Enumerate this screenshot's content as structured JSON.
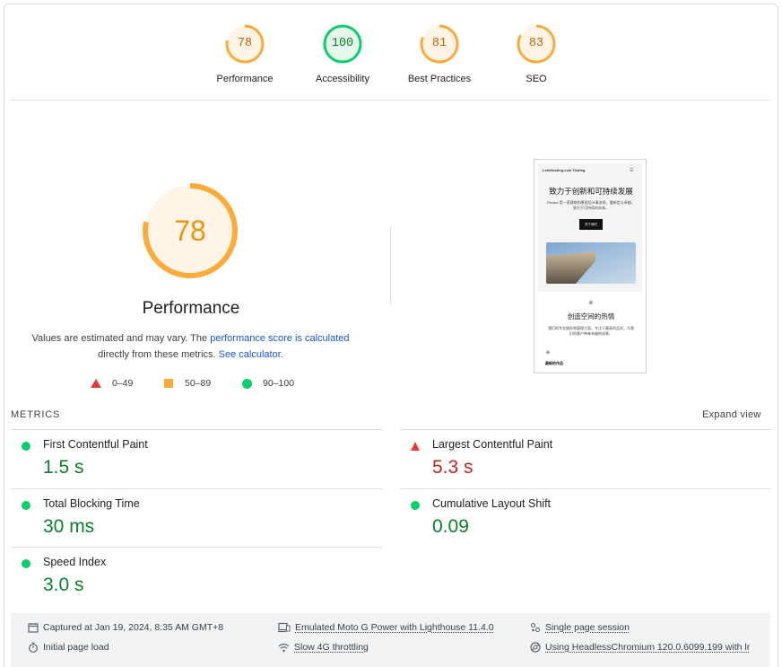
{
  "categories": [
    {
      "label": "Performance",
      "score": "78",
      "fraction": 0.78,
      "color": "#fbab3a",
      "fill": "#fff4e5",
      "text_color": "#c0640a"
    },
    {
      "label": "Accessibility",
      "score": "100",
      "fraction": 1.0,
      "color": "#0cce6b",
      "fill": "#e6f8ec",
      "text_color": "#0a7f2e"
    },
    {
      "label": "Best Practices",
      "score": "81",
      "fraction": 0.81,
      "color": "#fbab3a",
      "fill": "#fff4e5",
      "text_color": "#c0640a"
    },
    {
      "label": "SEO",
      "score": "83",
      "fraction": 0.83,
      "color": "#fbab3a",
      "fill": "#fff4e5",
      "text_color": "#c0640a"
    }
  ],
  "main": {
    "score": "78",
    "fraction": 0.78,
    "title": "Performance",
    "desc_prefix": "Values are estimated and may vary. The ",
    "desc_link": "performance score is calculated",
    "desc_middle": " directly from these metrics. ",
    "desc_link2": "See calculator",
    "desc_suffix": "."
  },
  "legend": {
    "fail": "0–49",
    "average": "50–89",
    "pass": "90–100"
  },
  "screenshot": {
    "brand": "LetsHosting.com Testing",
    "menu_icon": "☰",
    "heading": "致力于创新和可持续发展",
    "paragraph": "Études 是一家建筑和景观设计事务所，重新定义卓越，致力于可持续的未来。",
    "button": "关于我们",
    "ornament": "✳",
    "heading2": "创造空间的热情",
    "paragraph2": "我们的专业服务和管理方案，专注于最高的品质，为我们的客户带来卓越的成果。",
    "ornament2": "✳",
    "heading3": "最新的作品"
  },
  "metrics_header": "METRICS",
  "expand_view": "Expand view",
  "metrics": [
    {
      "name": "First Contentful Paint",
      "value": "1.5 s",
      "status": "pass"
    },
    {
      "name": "Largest Contentful Paint",
      "value": "5.3 s",
      "status": "fail"
    },
    {
      "name": "Total Blocking Time",
      "value": "30 ms",
      "status": "pass"
    },
    {
      "name": "Cumulative Layout Shift",
      "value": "0.09",
      "status": "pass"
    },
    {
      "name": "Speed Index",
      "value": "3.0 s",
      "status": "pass"
    }
  ],
  "footer": {
    "captured": "Captured at Jan 19, 2024, 8:35 AM GMT+8",
    "initial_load": "Initial page load",
    "device": "Emulated Moto G Power with Lighthouse 11.4.0",
    "throttling": "Slow 4G throttling",
    "session": "Single page session",
    "browser": "Using HeadlessChromium 120.0.6099.199 with lr"
  },
  "colors": {
    "pass": "#0cce6b",
    "average": "#fbab3a",
    "fail": "#e53935",
    "link": "#1a56c9"
  }
}
